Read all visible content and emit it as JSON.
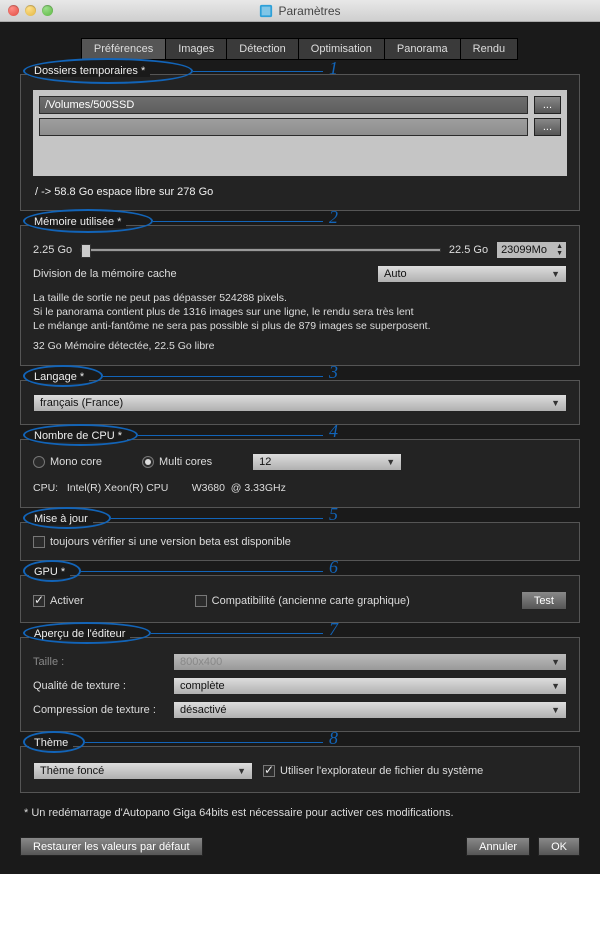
{
  "window_title": "Paramètres",
  "tabs": [
    "Préférences",
    "Images",
    "Détection",
    "Optimisation",
    "Panorama",
    "Rendu"
  ],
  "active_tab": 0,
  "sections": {
    "temp": {
      "title": "Dossiers temporaires *",
      "path1": "/Volumes/500SSD",
      "path2": "",
      "browse": "...",
      "freespace": "/ -> 58.8 Go espace libre sur 278 Go"
    },
    "memory": {
      "title": "Mémoire utilisée *",
      "min": "2.25 Go",
      "max": "22.5 Go",
      "value": "23099Mo",
      "cache_label": "Division de la mémoire cache",
      "cache_value": "Auto",
      "note1": "La taille de sortie ne peut pas dépasser 524288 pixels.",
      "note2": "Si le panorama contient plus de 1316 images sur une ligne, le rendu sera très lent",
      "note3": "Le mélange anti-fantôme ne sera pas possible si plus de 879 images se superposent.",
      "detected": "32 Go Mémoire détectée, 22.5 Go libre"
    },
    "language": {
      "title": "Langage *",
      "value": "français (France)"
    },
    "cpu": {
      "title": "Nombre de CPU *",
      "mono": "Mono core",
      "multi": "Multi cores",
      "multi_checked": true,
      "count": "12",
      "info": "CPU:   Intel(R) Xeon(R) CPU        W3680  @ 3.33GHz"
    },
    "update": {
      "title": "Mise à jour",
      "beta": "toujours vérifier si une version beta est disponible",
      "beta_checked": false
    },
    "gpu": {
      "title": "GPU *",
      "activate": "Activer",
      "activate_checked": true,
      "compat": "Compatibilité (ancienne carte graphique)",
      "compat_checked": false,
      "test": "Test"
    },
    "preview": {
      "title": "Aperçu de l'éditeur",
      "size_label": "Taille :",
      "size_value": "800x400",
      "quality_label": "Qualité de texture :",
      "quality_value": "complète",
      "compression_label": "Compression de texture :",
      "compression_value": "désactivé"
    },
    "theme": {
      "title": "Thème",
      "value": "Thème foncé",
      "explorer": "Utiliser l'explorateur de fichier du système",
      "explorer_checked": true
    }
  },
  "restart_note": "* Un redémarrage d'Autopano Giga 64bits est nécessaire pour activer ces modifications.",
  "buttons": {
    "restore": "Restaurer les valeurs par défaut",
    "cancel": "Annuler",
    "ok": "OK"
  },
  "callouts": [
    "1",
    "2",
    "3",
    "4",
    "5",
    "6",
    "7",
    "8"
  ]
}
